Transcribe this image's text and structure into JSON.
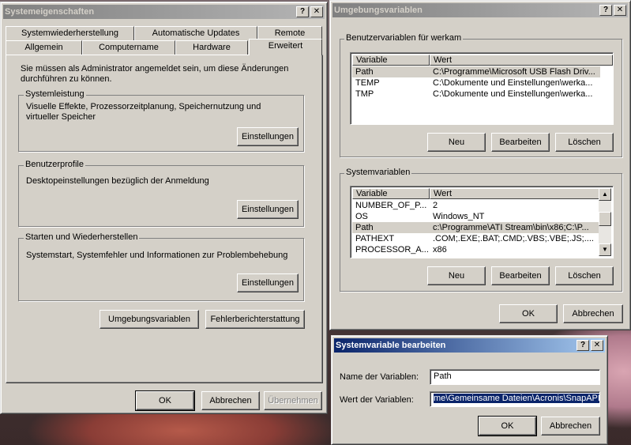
{
  "sysprops": {
    "title": "Systemeigenschaften",
    "help_label": "?",
    "close_label": "✕",
    "tabs_row1": [
      "Systemwiederherstellung",
      "Automatische Updates",
      "Remote"
    ],
    "tabs_row2": [
      "Allgemein",
      "Computername",
      "Hardware",
      "Erweitert"
    ],
    "admin_note": "Sie müssen als Administrator angemeldet sein, um diese Änderungen durchführen zu können.",
    "perf_group": "Systemleistung",
    "perf_text": "Visuelle Effekte, Prozessorzeitplanung, Speichernutzung und virtueller Speicher",
    "profiles_group": "Benutzerprofile",
    "profiles_text": "Desktopeinstellungen bezüglich der Anmeldung",
    "startup_group": "Starten und Wiederherstellen",
    "startup_text": "Systemstart, Systemfehler und Informationen zur Problembehebung",
    "settings_label": "Einstellungen",
    "envvars_label": "Umgebungsvariablen",
    "error_report_label": "Fehlerberichterstattung",
    "ok_label": "OK",
    "cancel_label": "Abbrechen",
    "apply_label": "Übernehmen"
  },
  "envvars": {
    "title": "Umgebungsvariablen",
    "help_label": "?",
    "close_label": "✕",
    "user_group": "Benutzervariablen für werkam",
    "col_variable": "Variable",
    "col_value": "Wert",
    "user_vars": [
      {
        "name": "Path",
        "value": "C:\\Programme\\Microsoft USB Flash Driv..."
      },
      {
        "name": "TEMP",
        "value": "C:\\Dokumente und Einstellungen\\werka..."
      },
      {
        "name": "TMP",
        "value": "C:\\Dokumente und Einstellungen\\werka..."
      }
    ],
    "system_group": "Systemvariablen",
    "system_vars": [
      {
        "name": "NUMBER_OF_P...",
        "value": "2"
      },
      {
        "name": "OS",
        "value": "Windows_NT"
      },
      {
        "name": "Path",
        "value": "c:\\Programme\\ATI Stream\\bin\\x86;C:\\P..."
      },
      {
        "name": "PATHEXT",
        "value": ".COM;.EXE;.BAT;.CMD;.VBS;.VBE;.JS;...."
      },
      {
        "name": "PROCESSOR_A...",
        "value": "x86"
      }
    ],
    "new_label": "Neu",
    "edit_label": "Bearbeiten",
    "delete_label": "Löschen",
    "ok_label": "OK",
    "cancel_label": "Abbrechen"
  },
  "editvar": {
    "title": "Systemvariable bearbeiten",
    "help_label": "?",
    "close_label": "✕",
    "name_label": "Name der Variablen:",
    "name_value": "Path",
    "value_label": "Wert der Variablen:",
    "value_value": "me\\Gemeinsame Dateien\\Acronis\\SnapAPI\\",
    "ok_label": "OK",
    "cancel_label": "Abbrechen"
  }
}
